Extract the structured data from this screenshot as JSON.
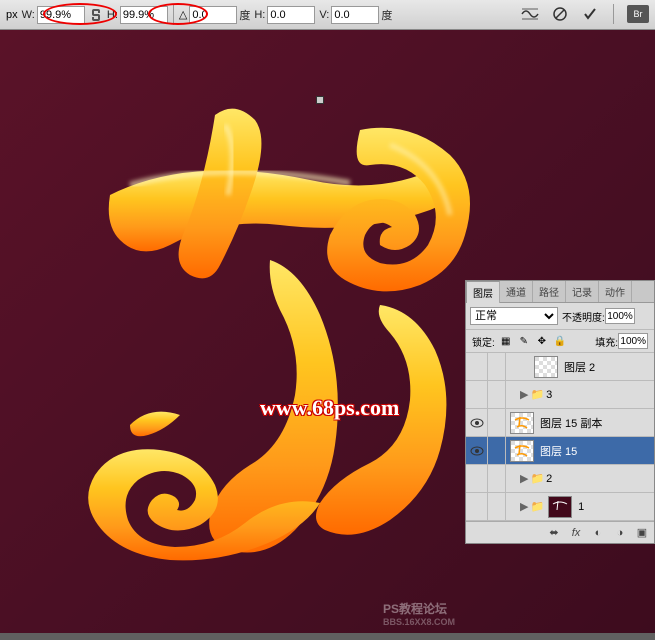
{
  "toolbar": {
    "x_unit": "px",
    "w_label": "W:",
    "w_value": "99.9%",
    "h_label": "H:",
    "h_value": "99.9%",
    "angle_value": "0.0",
    "angle_unit": "度",
    "hh_label": "H:",
    "hh_value": "0.0",
    "vv_label": "V:",
    "vv_value": "0.0",
    "vv_unit": "度"
  },
  "icons": {
    "link": "link-icon",
    "warp": "warp-icon",
    "cancel": "cancel-icon",
    "commit": "commit-icon",
    "brush": "brush-icon",
    "eye": "eye-icon"
  },
  "canvas": {
    "watermark": "www.68ps.com",
    "watermark2_main": "PS教程论坛",
    "watermark2_sub": "BBS.16XX8.COM"
  },
  "panel": {
    "tabs": [
      "图层",
      "通道",
      "路径",
      "记录",
      "动作"
    ],
    "active_tab": 0,
    "blend_mode": "正常",
    "opacity_label": "不透明度:",
    "opacity_value": "100%",
    "lock_label": "锁定:",
    "fill_label": "填充:",
    "fill_value": "100%",
    "layers": [
      {
        "name": "图层 2",
        "type": "layer",
        "visible": false,
        "thumb": "checker",
        "indent": 2
      },
      {
        "name": "3",
        "type": "group",
        "visible": false,
        "indent": 1
      },
      {
        "name": "图层 15 副本",
        "type": "layer",
        "visible": true,
        "thumb": "checker-art",
        "indent": 0
      },
      {
        "name": "图层 15",
        "type": "layer",
        "visible": true,
        "thumb": "checker-art",
        "indent": 0,
        "selected": true
      },
      {
        "name": "2",
        "type": "group",
        "visible": false,
        "indent": 1
      },
      {
        "name": "1",
        "type": "group",
        "visible": false,
        "thumb": "dark-art",
        "indent": 1
      }
    ]
  },
  "colors": {
    "accent": "#3d6aa8",
    "canvas_bg": "#4a0f24",
    "glyph_top": "#ffd633",
    "glyph_bottom": "#ff7a1a",
    "annotation": "#e00000"
  }
}
